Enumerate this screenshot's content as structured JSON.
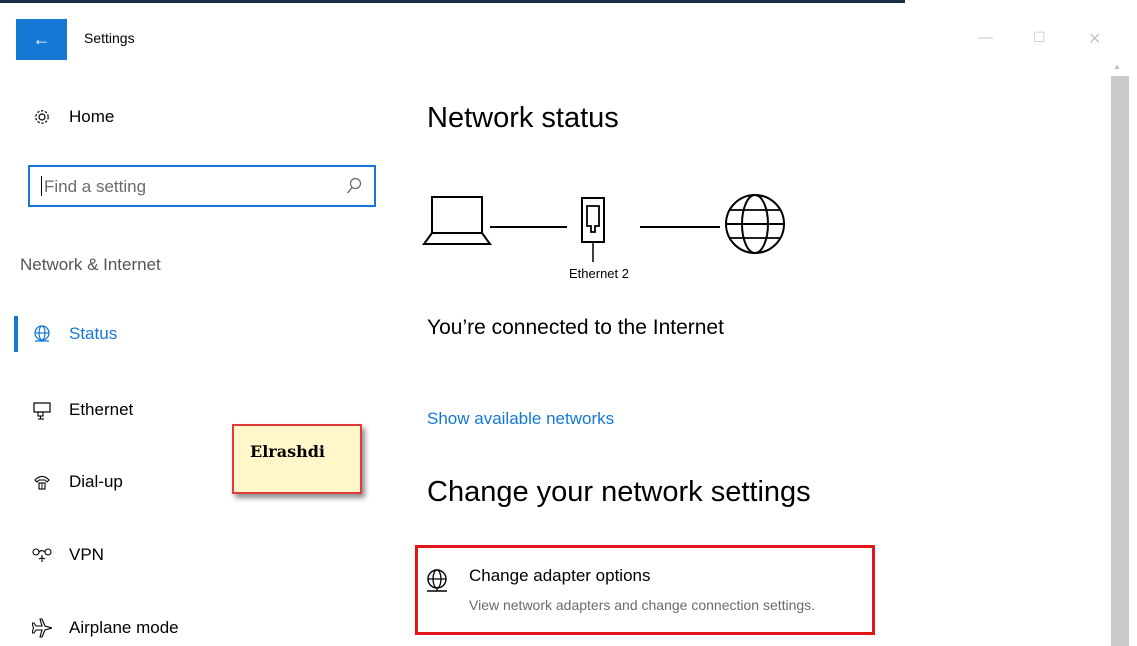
{
  "window": {
    "title": "Settings",
    "back_glyph": "←",
    "minimize_glyph": "—",
    "maximize_glyph": "☐",
    "close_glyph": "✕"
  },
  "sidebar": {
    "home_label": "Home",
    "search_placeholder": "Find a setting",
    "section_label": "Network & Internet",
    "items": [
      {
        "label": "Status",
        "icon": "globe-icon",
        "active": true
      },
      {
        "label": "Ethernet",
        "icon": "ethernet-icon",
        "active": false
      },
      {
        "label": "Dial-up",
        "icon": "dialup-icon",
        "active": false
      },
      {
        "label": "VPN",
        "icon": "vpn-icon",
        "active": false
      },
      {
        "label": "Airplane mode",
        "icon": "airplane-icon",
        "active": false
      }
    ]
  },
  "watermark": {
    "text": "Elrashdi"
  },
  "main": {
    "network_status_heading": "Network status",
    "adapter_name": "Ethernet 2",
    "connection_status": "You’re connected to the Internet",
    "show_networks_link": "Show available networks",
    "change_heading": "Change your network settings",
    "adapter_option": {
      "title": "Change adapter options",
      "description": "View network adapters and change connection settings."
    }
  },
  "colors": {
    "accent": "#1478d4",
    "highlight_border": "#e0161b",
    "watermark_bg": "#fff6c9"
  }
}
